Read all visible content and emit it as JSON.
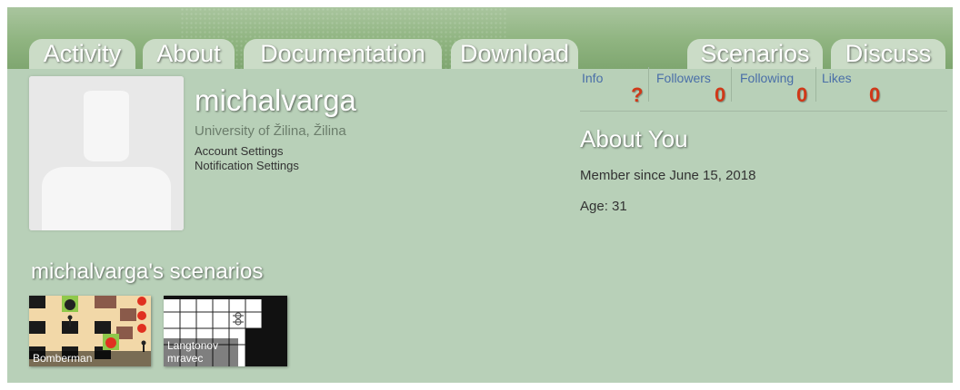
{
  "nav": {
    "tabs": [
      {
        "label": "Activity"
      },
      {
        "label": "About"
      },
      {
        "label": "Documentation"
      },
      {
        "label": "Download"
      },
      {
        "label": "Scenarios"
      },
      {
        "label": "Discuss"
      }
    ]
  },
  "profile": {
    "username": "michalvarga",
    "institution": "University of Žilina, Žilina",
    "account_settings_label": "Account Settings",
    "notification_settings_label": "Notification Settings",
    "avatar_icon": "default-user-silhouette"
  },
  "stats": {
    "info": {
      "label": "Info",
      "value": "?"
    },
    "followers": {
      "label": "Followers",
      "value": "0"
    },
    "following": {
      "label": "Following",
      "value": "0"
    },
    "likes": {
      "label": "Likes",
      "value": "0"
    }
  },
  "about": {
    "title": "About You",
    "member_since": "Member since June 15, 2018",
    "age": "Age: 31"
  },
  "scenarios": {
    "title": "michalvarga's scenarios",
    "items": [
      {
        "name": "Bomberman"
      },
      {
        "name": "Langtonov mravec"
      }
    ]
  },
  "colors": {
    "background": "#b8d0b8",
    "tab": "#cbdcc7",
    "stat_value": "#d03818",
    "stat_label": "#4a6fa8"
  }
}
